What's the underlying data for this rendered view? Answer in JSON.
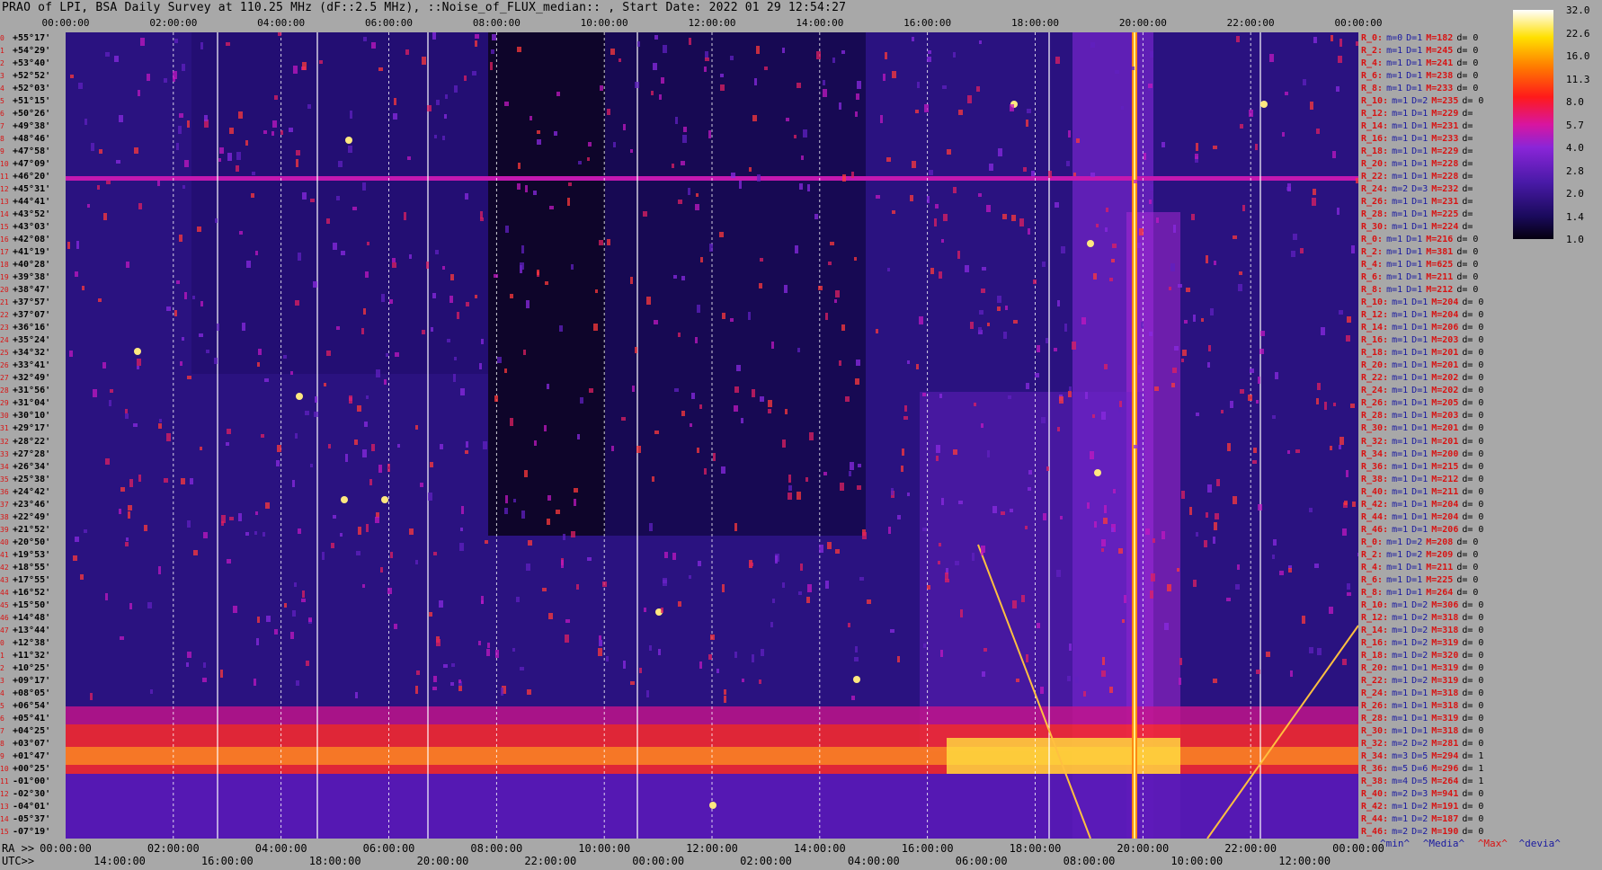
{
  "title": "PRAO of LPI, BSA Daily Survey at 110.25 MHz (dF::2.5 MHz), ::Noise_of_FLUX_median:: , Start Date: 2022 01 29 12:54:27",
  "top_time_ticks": [
    "00:00:00",
    "02:00:00",
    "04:00:00",
    "06:00:00",
    "08:00:00",
    "10:00:00",
    "12:00:00",
    "14:00:00",
    "16:00:00",
    "18:00:00",
    "20:00:00",
    "22:00:00",
    "00:00:00"
  ],
  "ra_prefix": "RA >>",
  "ra_ticks": [
    "00:00:00",
    "02:00:00",
    "04:00:00",
    "06:00:00",
    "08:00:00",
    "10:00:00",
    "12:00:00",
    "14:00:00",
    "16:00:00",
    "18:00:00",
    "20:00:00",
    "22:00:00",
    "00:00:00"
  ],
  "utc_prefix": "UTC>>",
  "utc_ticks": [
    "14:00:00",
    "16:00:00",
    "18:00:00",
    "20:00:00",
    "22:00:00",
    "00:00:00",
    "02:00:00",
    "04:00:00",
    "06:00:00",
    "08:00:00",
    "10:00:00",
    "12:00:00"
  ],
  "declinations": [
    "+55°17'",
    "+54°29'",
    "+53°40'",
    "+52°52'",
    "+52°03'",
    "+51°15'",
    "+50°26'",
    "+49°38'",
    "+48°46'",
    "+47°58'",
    "+47°09'",
    "+46°20'",
    "+45°31'",
    "+44°41'",
    "+43°52'",
    "+43°03'",
    "+42°08'",
    "+41°19'",
    "+40°28'",
    "+39°38'",
    "+38°47'",
    "+37°57'",
    "+37°07'",
    "+36°16'",
    "+35°24'",
    "+34°32'",
    "+33°41'",
    "+32°49'",
    "+31°56'",
    "+31°04'",
    "+30°10'",
    "+29°17'",
    "+28°22'",
    "+27°28'",
    "+26°34'",
    "+25°38'",
    "+24°42'",
    "+23°46'",
    "+22°49'",
    "+21°52'",
    "+20°50'",
    "+19°53'",
    "+18°55'",
    "+17°55'",
    "+16°52'",
    "+15°50'",
    "+14°48'",
    "+13°44'",
    "+12°38'",
    "+11°32'",
    "+10°25'",
    "+09°17'",
    "+08°05'",
    "+06°54'",
    "+05°41'",
    "+04°25'",
    "+03°07'",
    "+01°47'",
    "+00°25'",
    "-01°00'",
    "-02°30'",
    "-04°01'",
    "-05°37'",
    "-07°19'"
  ],
  "dec_index": [
    "0",
    "1",
    "2",
    "3",
    "4",
    "5",
    "6",
    "7",
    "8",
    "9",
    "10",
    "11",
    "12",
    "13",
    "14",
    "15",
    "16",
    "17",
    "18",
    "19",
    "20",
    "21",
    "22",
    "23",
    "24",
    "25",
    "26",
    "27",
    "28",
    "29",
    "30",
    "31",
    "32",
    "33",
    "34",
    "35",
    "36",
    "37",
    "38",
    "39",
    "40",
    "41",
    "42",
    "43",
    "44",
    "45",
    "46",
    "47",
    "0",
    "1",
    "2",
    "3",
    "4",
    "5",
    "6",
    "7",
    "8",
    "9",
    "10",
    "11",
    "12",
    "13",
    "14",
    "15"
  ],
  "stats": [
    {
      "r": "R_0:",
      "m": "m=0",
      "d": "D=1",
      "M": "M=182",
      "dd": "d= 0"
    },
    {
      "r": "R_2:",
      "m": "m=1",
      "d": "D=1",
      "M": "M=245",
      "dd": "d= 0"
    },
    {
      "r": "R_4:",
      "m": "m=1",
      "d": "D=1",
      "M": "M=241",
      "dd": "d= 0"
    },
    {
      "r": "R_6:",
      "m": "m=1",
      "d": "D=1",
      "M": "M=238",
      "dd": "d= 0"
    },
    {
      "r": "R_8:",
      "m": "m=1",
      "d": "D=1",
      "M": "M=233",
      "dd": "d= 0"
    },
    {
      "r": "R_10:",
      "m": "m=1",
      "d": "D=2",
      "M": "M=235",
      "dd": "d= 0"
    },
    {
      "r": "R_12:",
      "m": "m=1",
      "d": "D=1",
      "M": "M=229",
      "dd": "d="
    },
    {
      "r": "R_14:",
      "m": "m=1",
      "d": "D=1",
      "M": "M=231",
      "dd": "d="
    },
    {
      "r": "R_16:",
      "m": "m=1",
      "d": "D=1",
      "M": "M=233",
      "dd": "d="
    },
    {
      "r": "R_18:",
      "m": "m=1",
      "d": "D=1",
      "M": "M=229",
      "dd": "d="
    },
    {
      "r": "R_20:",
      "m": "m=1",
      "d": "D=1",
      "M": "M=228",
      "dd": "d="
    },
    {
      "r": "R_22:",
      "m": "m=1",
      "d": "D=1",
      "M": "M=228",
      "dd": "d="
    },
    {
      "r": "R_24:",
      "m": "m=2",
      "d": "D=3",
      "M": "M=232",
      "dd": "d="
    },
    {
      "r": "R_26:",
      "m": "m=1",
      "d": "D=1",
      "M": "M=231",
      "dd": "d="
    },
    {
      "r": "R_28:",
      "m": "m=1",
      "d": "D=1",
      "M": "M=225",
      "dd": "d="
    },
    {
      "r": "R_30:",
      "m": "m=1",
      "d": "D=1",
      "M": "M=224",
      "dd": "d="
    },
    {
      "r": "R_0:",
      "m": "m=1",
      "d": "D=1",
      "M": "M=216",
      "dd": "d= 0"
    },
    {
      "r": "R_2:",
      "m": "m=1",
      "d": "D=1",
      "M": "M=381",
      "dd": "d= 0"
    },
    {
      "r": "R_4:",
      "m": "m=1",
      "d": "D=1",
      "M": "M=625",
      "dd": "d= 0"
    },
    {
      "r": "R_6:",
      "m": "m=1",
      "d": "D=1",
      "M": "M=211",
      "dd": "d= 0"
    },
    {
      "r": "R_8:",
      "m": "m=1",
      "d": "D=1",
      "M": "M=212",
      "dd": "d= 0"
    },
    {
      "r": "R_10:",
      "m": "m=1",
      "d": "D=1",
      "M": "M=204",
      "dd": "d= 0"
    },
    {
      "r": "R_12:",
      "m": "m=1",
      "d": "D=1",
      "M": "M=204",
      "dd": "d= 0"
    },
    {
      "r": "R_14:",
      "m": "m=1",
      "d": "D=1",
      "M": "M=206",
      "dd": "d= 0"
    },
    {
      "r": "R_16:",
      "m": "m=1",
      "d": "D=1",
      "M": "M=203",
      "dd": "d= 0"
    },
    {
      "r": "R_18:",
      "m": "m=1",
      "d": "D=1",
      "M": "M=201",
      "dd": "d= 0"
    },
    {
      "r": "R_20:",
      "m": "m=1",
      "d": "D=1",
      "M": "M=201",
      "dd": "d= 0"
    },
    {
      "r": "R_22:",
      "m": "m=1",
      "d": "D=1",
      "M": "M=202",
      "dd": "d= 0"
    },
    {
      "r": "R_24:",
      "m": "m=1",
      "d": "D=1",
      "M": "M=202",
      "dd": "d= 0"
    },
    {
      "r": "R_26:",
      "m": "m=1",
      "d": "D=1",
      "M": "M=205",
      "dd": "d= 0"
    },
    {
      "r": "R_28:",
      "m": "m=1",
      "d": "D=1",
      "M": "M=203",
      "dd": "d= 0"
    },
    {
      "r": "R_30:",
      "m": "m=1",
      "d": "D=1",
      "M": "M=201",
      "dd": "d= 0"
    },
    {
      "r": "R_32:",
      "m": "m=1",
      "d": "D=1",
      "M": "M=201",
      "dd": "d= 0"
    },
    {
      "r": "R_34:",
      "m": "m=1",
      "d": "D=1",
      "M": "M=200",
      "dd": "d= 0"
    },
    {
      "r": "R_36:",
      "m": "m=1",
      "d": "D=1",
      "M": "M=215",
      "dd": "d= 0"
    },
    {
      "r": "R_38:",
      "m": "m=1",
      "d": "D=1",
      "M": "M=212",
      "dd": "d= 0"
    },
    {
      "r": "R_40:",
      "m": "m=1",
      "d": "D=1",
      "M": "M=211",
      "dd": "d= 0"
    },
    {
      "r": "R_42:",
      "m": "m=1",
      "d": "D=1",
      "M": "M=204",
      "dd": "d= 0"
    },
    {
      "r": "R_44:",
      "m": "m=1",
      "d": "D=1",
      "M": "M=204",
      "dd": "d= 0"
    },
    {
      "r": "R_46:",
      "m": "m=1",
      "d": "D=1",
      "M": "M=206",
      "dd": "d= 0"
    },
    {
      "r": "R_0:",
      "m": "m=1",
      "d": "D=2",
      "M": "M=208",
      "dd": "d= 0"
    },
    {
      "r": "R_2:",
      "m": "m=1",
      "d": "D=2",
      "M": "M=209",
      "dd": "d= 0"
    },
    {
      "r": "R_4:",
      "m": "m=1",
      "d": "D=1",
      "M": "M=211",
      "dd": "d= 0"
    },
    {
      "r": "R_6:",
      "m": "m=1",
      "d": "D=1",
      "M": "M=225",
      "dd": "d= 0"
    },
    {
      "r": "R_8:",
      "m": "m=1",
      "d": "D=1",
      "M": "M=264",
      "dd": "d= 0"
    },
    {
      "r": "R_10:",
      "m": "m=1",
      "d": "D=2",
      "M": "M=306",
      "dd": "d= 0"
    },
    {
      "r": "R_12:",
      "m": "m=1",
      "d": "D=2",
      "M": "M=318",
      "dd": "d= 0"
    },
    {
      "r": "R_14:",
      "m": "m=1",
      "d": "D=2",
      "M": "M=318",
      "dd": "d= 0"
    },
    {
      "r": "R_16:",
      "m": "m=1",
      "d": "D=2",
      "M": "M=319",
      "dd": "d= 0"
    },
    {
      "r": "R_18:",
      "m": "m=1",
      "d": "D=2",
      "M": "M=320",
      "dd": "d= 0"
    },
    {
      "r": "R_20:",
      "m": "m=1",
      "d": "D=1",
      "M": "M=319",
      "dd": "d= 0"
    },
    {
      "r": "R_22:",
      "m": "m=1",
      "d": "D=2",
      "M": "M=319",
      "dd": "d= 0"
    },
    {
      "r": "R_24:",
      "m": "m=1",
      "d": "D=1",
      "M": "M=318",
      "dd": "d= 0"
    },
    {
      "r": "R_26:",
      "m": "m=1",
      "d": "D=1",
      "M": "M=318",
      "dd": "d= 0"
    },
    {
      "r": "R_28:",
      "m": "m=1",
      "d": "D=1",
      "M": "M=319",
      "dd": "d= 0"
    },
    {
      "r": "R_30:",
      "m": "m=1",
      "d": "D=1",
      "M": "M=318",
      "dd": "d= 0"
    },
    {
      "r": "R_32:",
      "m": "m=2",
      "d": "D=2",
      "M": "M=281",
      "dd": "d= 0"
    },
    {
      "r": "R_34:",
      "m": "m=3",
      "d": "D=5",
      "M": "M=294",
      "dd": "d= 1"
    },
    {
      "r": "R_36:",
      "m": "m=5",
      "d": "D=6",
      "M": "M=296",
      "dd": "d= 1"
    },
    {
      "r": "R_38:",
      "m": "m=4",
      "d": "D=5",
      "M": "M=264",
      "dd": "d= 1"
    },
    {
      "r": "R_40:",
      "m": "m=2",
      "d": "D=3",
      "M": "M=941",
      "dd": "d= 0"
    },
    {
      "r": "R_42:",
      "m": "m=1",
      "d": "D=2",
      "M": "M=191",
      "dd": "d= 0"
    },
    {
      "r": "R_44:",
      "m": "m=1",
      "d": "D=2",
      "M": "M=187",
      "dd": "d= 0"
    },
    {
      "r": "R_46:",
      "m": "m=2",
      "d": "D=2",
      "M": "M=190",
      "dd": "d= 0"
    }
  ],
  "colorbar": {
    "ticks": [
      "32.0",
      "22.6",
      "16.0",
      "11.3",
      "8.0",
      "5.7",
      "4.0",
      "2.8",
      "2.0",
      "1.4",
      "1.0"
    ]
  },
  "legend": {
    "min": "^min^",
    "median": "^Media^",
    "max": "^Max^",
    "devia": "^devia^",
    "colors": {
      "min": "#1a1aa0",
      "median": "#1a1aa0",
      "max": "#d81414",
      "devia": "#1a1aa0"
    }
  }
}
